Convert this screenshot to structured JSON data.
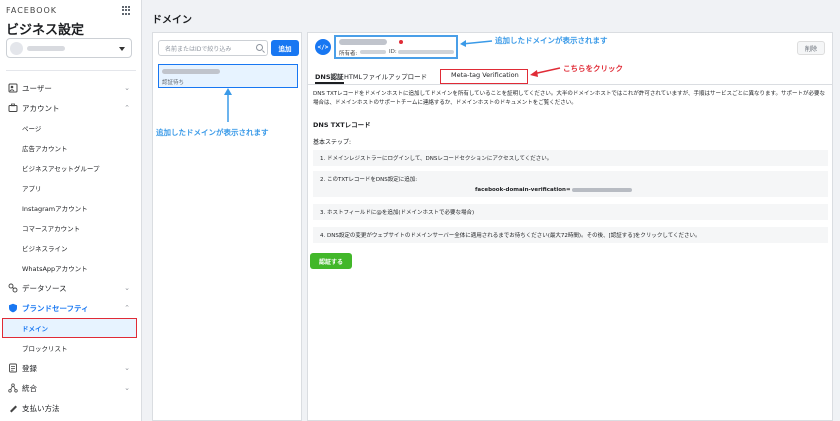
{
  "sidebar": {
    "brand": "FACEBOOK",
    "title": "ビジネス設定",
    "nav": [
      {
        "label": "ユーザー",
        "icon": "users-icon",
        "chevron": "⌄"
      },
      {
        "label": "アカウント",
        "icon": "briefcase-icon",
        "chevron": "⌃"
      },
      {
        "label": "データソース",
        "icon": "data-sources-icon",
        "chevron": "⌄"
      },
      {
        "label": "ブランドセーフティ",
        "icon": "shield-icon",
        "chevron": "⌃"
      },
      {
        "label": "登録",
        "icon": "register-icon",
        "chevron": "⌄"
      },
      {
        "label": "統合",
        "icon": "integrations-icon",
        "chevron": "⌄"
      },
      {
        "label": "支払い方法",
        "icon": "payment-icon",
        "chevron": ""
      }
    ],
    "account_sub": [
      "ページ",
      "広告アカウント",
      "ビジネスアセットグループ",
      "アプリ",
      "Instagramアカウント",
      "コマースアカウント",
      "ビジネスライン",
      "WhatsAppアカウント"
    ],
    "brand_safety_sub": [
      "ドメイン",
      "ブロックリスト"
    ]
  },
  "main": {
    "title": "ドメイン",
    "search_placeholder": "名前またはIDで絞り込み",
    "add_label": "追加",
    "list_item_status": "認証待ち",
    "owner_label": "所有者:",
    "id_label": "ID:",
    "delete_label": "削除",
    "tabs": [
      "DNS認証",
      "HTMLファイルアップロード",
      "Meta-tag Verification"
    ],
    "description": "DNS TXTレコードをドメインホストに追加してドメインを所有していることを証明してください。大半のドメインホストではこれが許可されていますが、手順はサービスごとに異なります。サポートが必要な場合は、ドメインホストのサポートチームに連絡するか、ドメインホストのドキュメントをご覧ください。",
    "section_title": "DNS TXTレコード",
    "steps_label": "基本ステップ:",
    "steps": [
      "1. ドメインレジストラーにログインして、DNSレコードセクションにアクセスしてください。",
      "2. このTXTレコードをDNS設定に追加:",
      "3. ホストフィールドに@を追加(ドメインホストで必要な場合)",
      "4. DNS設定の変更がウェブサイトのドメインサーバー全体に適用されるまでお待ちください(最大72時間)。その後、[認証する]をクリックしてください。"
    ],
    "txt_record": "facebook-domain-verification=",
    "verify_label": "認証する"
  },
  "annotations": {
    "top": "追加したドメインが表示されます",
    "left": "追加したドメインが表示されます",
    "click": "こちらをクリック"
  }
}
